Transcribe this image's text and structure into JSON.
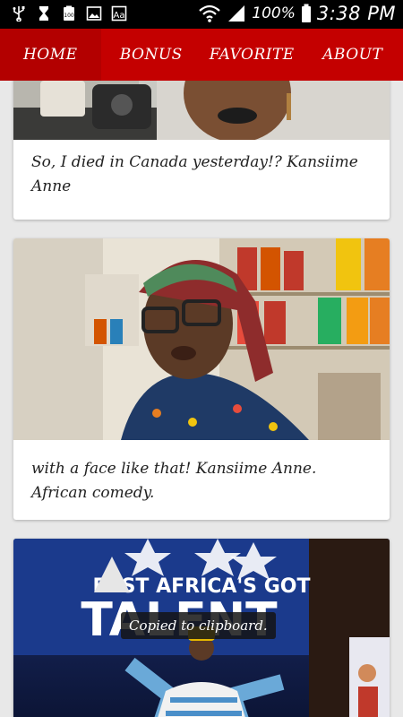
{
  "status_bar": {
    "battery_percent": "100%",
    "time": "3:38 PM",
    "icons": [
      "usb-icon",
      "hourglass-icon",
      "battery-100-icon",
      "image-icon",
      "font-icon",
      "wifi-icon",
      "signal-icon",
      "battery-icon"
    ]
  },
  "nav": {
    "tabs": [
      {
        "label": "HOME",
        "active": true
      },
      {
        "label": "BONUS",
        "active": false
      },
      {
        "label": "FAVORITE",
        "active": false
      },
      {
        "label": "ABOUT",
        "active": false
      }
    ]
  },
  "cards": [
    {
      "title": "So, I died in Canada yesterday!? Kansiime Anne"
    },
    {
      "title": "with a face like that! Kansiime Anne. African comedy."
    },
    {
      "title": "",
      "image_text": {
        "line1": "EAST AFRICA'S GOT",
        "line2": "TALENT"
      }
    }
  ],
  "toast": {
    "text": "Copied to clipboard."
  },
  "colors": {
    "nav_bg": "#c40000",
    "status_bg": "#000000",
    "card_bg": "#ffffff"
  }
}
